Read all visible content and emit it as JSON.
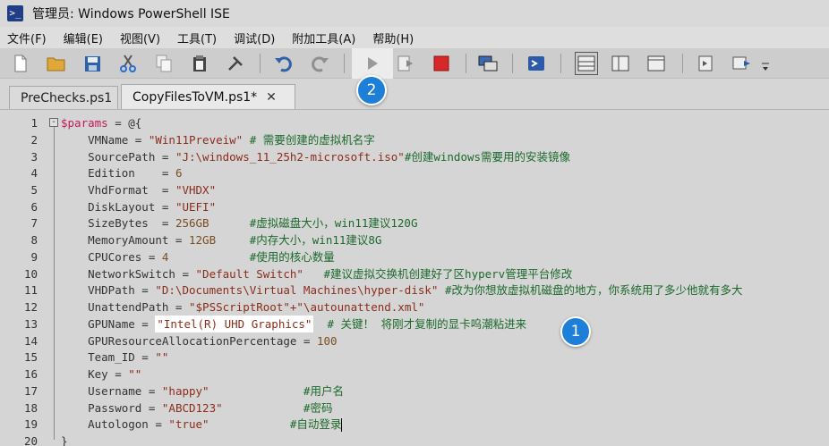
{
  "window": {
    "title": "管理员: Windows PowerShell ISE"
  },
  "menu": [
    "文件(F)",
    "编辑(E)",
    "视图(V)",
    "工具(T)",
    "调试(D)",
    "附加工具(A)",
    "帮助(H)"
  ],
  "tabs": [
    {
      "label": "PreChecks.ps1",
      "active": false
    },
    {
      "label": "CopyFilesToVM.ps1*",
      "active": true
    }
  ],
  "badges": {
    "one": "1",
    "two": "2"
  },
  "fold_symbol": "-",
  "code": {
    "l1": {
      "num": "1",
      "var": "$params",
      "rest": " = @{"
    },
    "l2": {
      "num": "2",
      "key": "    VMName = ",
      "val": "\"Win11Preveiw\"",
      "cm": " # 需要创建的虚拟机名字"
    },
    "l3": {
      "num": "3",
      "key": "    SourcePath = ",
      "val": "\"J:\\windows_11_25h2-microsoft.iso\"",
      "cm": "#创建windows需要用的安装镜像"
    },
    "l4": {
      "num": "4",
      "key": "    Edition    = ",
      "val": "6"
    },
    "l5": {
      "num": "5",
      "key": "    VhdFormat  = ",
      "val": "\"VHDX\""
    },
    "l6": {
      "num": "6",
      "key": "    DiskLayout = ",
      "val": "\"UEFI\""
    },
    "l7": {
      "num": "7",
      "key": "    SizeBytes  = ",
      "val": "256GB",
      "cm": "      #虚拟磁盘大小，win11建议120G"
    },
    "l8": {
      "num": "8",
      "key": "    MemoryAmount = ",
      "val": "12GB",
      "cm": "     #内存大小，win11建议8G"
    },
    "l9": {
      "num": "9",
      "key": "    CPUCores = ",
      "val": "4",
      "cm": "            #使用的核心数量"
    },
    "l10": {
      "num": "10",
      "key": "    NetworkSwitch = ",
      "val": "\"Default Switch\"",
      "cm": "   #建议虚拟交换机创建好了区hyperv管理平台修改"
    },
    "l11": {
      "num": "11",
      "key": "    VHDPath = ",
      "val": "\"D:\\Documents\\Virtual Machines\\hyper-disk\"",
      "cm": " #改为你想放虚拟机磁盘的地方，你系统用了多少他就有多大"
    },
    "l12": {
      "num": "12",
      "key": "    UnattendPath = ",
      "val": "\"$PSScriptRoot\"+\"\\autounattend.xml\""
    },
    "l13": {
      "num": "13",
      "key": "    GPUName = ",
      "val": "\"Intel(R) UHD Graphics\"",
      "cm": "  # 关键！ 将刚才复制的显卡呜潮粘进来"
    },
    "l14": {
      "num": "14",
      "key": "    GPUResourceAllocationPercentage = ",
      "val": "100"
    },
    "l15": {
      "num": "15",
      "key": "    Team_ID = ",
      "val": "\"\""
    },
    "l16": {
      "num": "16",
      "key": "    Key = ",
      "val": "\"\""
    },
    "l17": {
      "num": "17",
      "key": "    Username = ",
      "val": "\"happy\"",
      "cm": "              #用户名"
    },
    "l18": {
      "num": "18",
      "key": "    Password = ",
      "val": "\"ABCD123\"",
      "cm": "            #密码"
    },
    "l19": {
      "num": "19",
      "key": "    Autologon = ",
      "val": "\"true\"",
      "cm": "            #自动登录"
    },
    "l20": {
      "num": "20",
      "rest": "}"
    }
  },
  "icons": [
    "new-file-icon",
    "open-folder-icon",
    "save-icon",
    "cut-icon",
    "copy-icon",
    "paste-icon",
    "clear-icon",
    "undo-icon",
    "redo-icon",
    "run-script-icon",
    "run-selection-icon",
    "stop-icon",
    "remote-powershell-icon",
    "powershell-console-icon",
    "show-script-top-icon",
    "show-script-right-icon",
    "show-script-maximized-icon",
    "show-command-icon",
    "show-addon-icon"
  ],
  "colors": {
    "badge": "#1e7fd8",
    "stop": "#d62828",
    "variable": "#c2185b",
    "string": "#8b2d1b",
    "comment": "#1b6a2b"
  }
}
